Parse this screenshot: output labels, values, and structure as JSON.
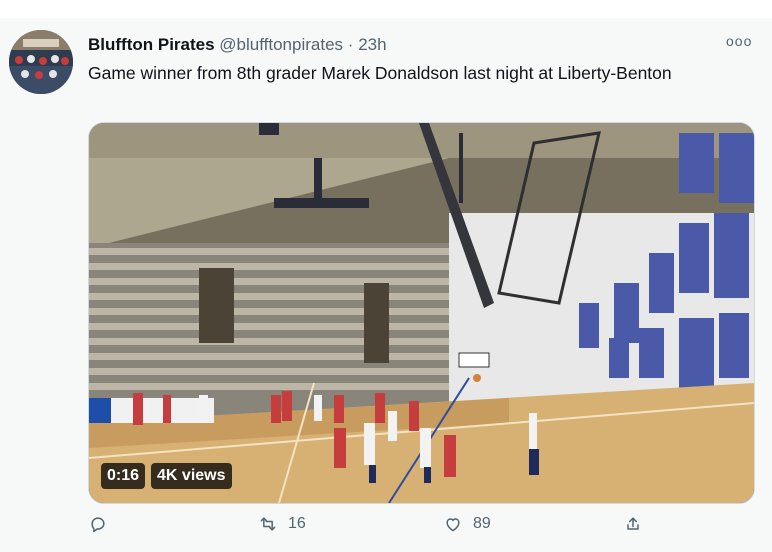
{
  "tweet": {
    "author_name": "Bluffton Pirates",
    "handle": "@blufftonpirates",
    "separator": "·",
    "time": "23h",
    "more_label": "ooo",
    "text": "Game winner from 8th grader Marek Donaldson last night at Liberty-Benton"
  },
  "video": {
    "duration": "0:16",
    "views": "4K views"
  },
  "actions": {
    "reply_count": "",
    "retweet_count": "16",
    "like_count": "89"
  },
  "icons": [
    "reply-icon",
    "retweet-icon",
    "like-icon",
    "share-icon"
  ],
  "colors": {
    "text": "#0f1419",
    "muted": "#536471",
    "background": "#f7f9f9"
  }
}
